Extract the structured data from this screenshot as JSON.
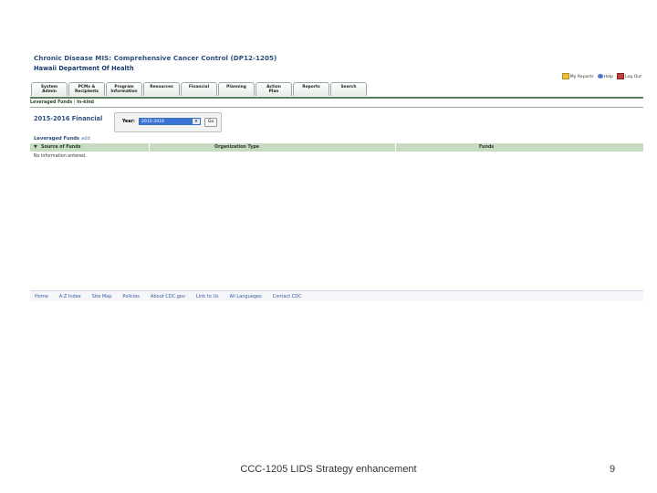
{
  "app": {
    "title": "Chronic Disease MIS: Comprehensive Cancer Control (DP12-1205)",
    "subtitle": "Hawaii Department Of Health"
  },
  "utility": {
    "my_reports": "My Reports",
    "help": "Help",
    "logout": "Log Out"
  },
  "tabs": [
    {
      "line1": "System",
      "line2": "Admin"
    },
    {
      "line1": "PCMs &",
      "line2": "Recipients"
    },
    {
      "line1": "Program",
      "line2": "Information"
    },
    {
      "line1": "Resources",
      "line2": ""
    },
    {
      "line1": "Financial",
      "line2": ""
    },
    {
      "line1": "Planning",
      "line2": ""
    },
    {
      "line1": "Action",
      "line2": "Plan"
    },
    {
      "line1": "Reports",
      "line2": ""
    },
    {
      "line1": "Search",
      "line2": ""
    }
  ],
  "subnav": {
    "leveraged": "Leveraged Funds",
    "inkind": "In-kind"
  },
  "section": {
    "title": "2015-2016 Financial"
  },
  "year_selector": {
    "label": "Year:",
    "selected": "2015-2016",
    "go": "Go"
  },
  "leveraged_funds": {
    "label": "Leveraged Funds",
    "add": "add",
    "columns": [
      "Source of Funds",
      "Organization Type",
      "Funds"
    ],
    "empty_message": "No information entered."
  },
  "footer": {
    "links": [
      "Home",
      "A-Z Index",
      "Site Map",
      "Policies",
      "About CDC.gov",
      "Link to Us",
      "All Languages",
      "Contact CDC"
    ]
  },
  "slide": {
    "caption": "CCC-1205 LIDS Strategy enhancement",
    "page_number": "9"
  },
  "colors": {
    "title_blue": "#2b4f7e",
    "table_header_green": "#c6dbc0",
    "select_blue": "#3b74d4"
  }
}
